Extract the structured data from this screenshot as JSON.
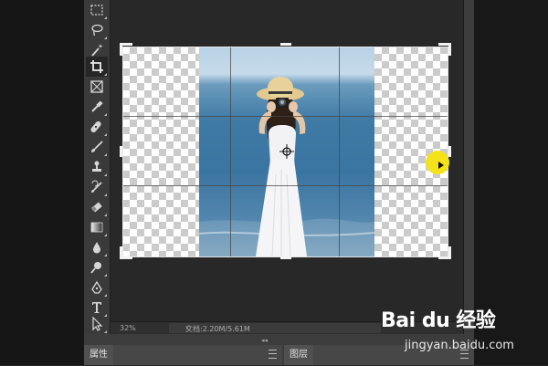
{
  "toolbar": {
    "tools": [
      {
        "icon": "marquee-icon"
      },
      {
        "icon": "lasso-icon"
      },
      {
        "icon": "magic-wand-icon"
      },
      {
        "icon": "crop-icon",
        "active": true
      },
      {
        "icon": "frame-icon"
      },
      {
        "icon": "eyedropper-icon"
      },
      {
        "icon": "healing-brush-icon"
      },
      {
        "icon": "brush-icon"
      },
      {
        "icon": "clone-stamp-icon"
      },
      {
        "icon": "history-brush-icon"
      },
      {
        "icon": "eraser-icon"
      },
      {
        "icon": "gradient-icon"
      },
      {
        "icon": "blur-icon"
      },
      {
        "icon": "dodge-icon"
      },
      {
        "icon": "pen-icon"
      },
      {
        "icon": "type-icon"
      },
      {
        "icon": "path-selection-icon"
      }
    ]
  },
  "status_bar": {
    "zoom": "32%",
    "doc_info": "文档:2.20M/5.61M",
    "arrow": "›"
  },
  "panels": {
    "properties_tab": "属性",
    "layers_tab": "图层",
    "collapse_glyph": "◂◂"
  },
  "watermark": {
    "logo": "Bai du 经验",
    "url": "jingyan.baidu.com"
  },
  "colors": {
    "cursor_highlight": "#f4e21b",
    "crop_border": "#e8e8e8"
  }
}
